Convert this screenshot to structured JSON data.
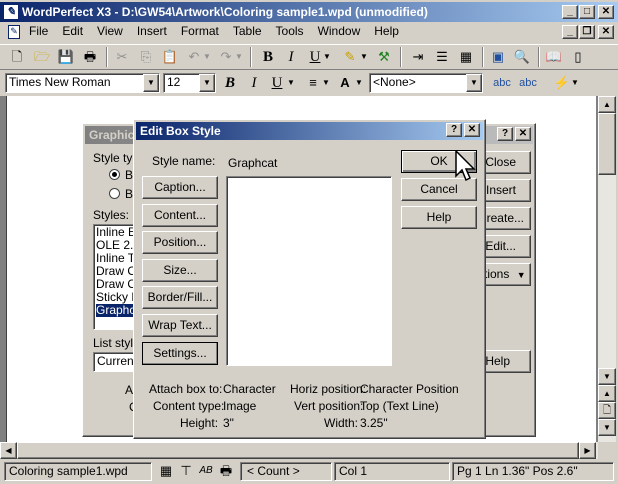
{
  "window": {
    "title": "WordPerfect X3 - D:\\GW54\\Artwork\\Coloring sample1.wpd (unmodified)"
  },
  "menu": [
    "File",
    "Edit",
    "View",
    "Insert",
    "Format",
    "Table",
    "Tools",
    "Window",
    "Help"
  ],
  "font_bar": {
    "font": "Times New Roman",
    "size": "12",
    "style": "<None>"
  },
  "back_dialog": {
    "title": "Graphic",
    "style_type_label": "Style typ",
    "radio1": "B",
    "radio2": "B",
    "styles_label": "Styles:",
    "styles": [
      "Inline Eq",
      "OLE 2.0",
      "Inline Te",
      "Draw O",
      "Draw O",
      "Sticky N",
      "Graphca"
    ],
    "list_style_label": "List style",
    "list_style_value": "Current",
    "btn_close": "Close",
    "btn_insert": "Insert",
    "btn_create": "Create...",
    "btn_edit": "Edit...",
    "btn_options": "Options",
    "btn_help": "Help",
    "a_label": "A",
    "c_label": "C"
  },
  "dialog": {
    "title": "Edit Box Style",
    "style_name_label": "Style name:",
    "style_name_value": "Graphcat",
    "buttons": [
      "Caption...",
      "Content...",
      "Position...",
      "Size...",
      "Border/Fill...",
      "Wrap Text...",
      "Settings..."
    ],
    "ok": "OK",
    "cancel": "Cancel",
    "help": "Help",
    "info": {
      "attach_label": "Attach box to:",
      "attach_value": "Character",
      "content_label": "Content type:",
      "content_value": "Image",
      "height_label": "Height:",
      "height_value": "3\"",
      "horiz_label": "Horiz position:",
      "horiz_value": "Character Position",
      "vert_label": "Vert position:",
      "vert_value": "Top  (Text Line)",
      "width_label": "Width:",
      "width_value": "3.25\""
    }
  },
  "status": {
    "filename": "Coloring sample1.wpd",
    "count": "< Count >",
    "col": "Col 1",
    "position": "Pg 1 Ln 1.36\" Pos 2.6\""
  },
  "colors": {
    "titlebar": "#0a246a",
    "face": "#d4d0c8",
    "selection": "#0a246a"
  },
  "icons": [
    "new-icon",
    "open-icon",
    "save-icon",
    "print-icon",
    "cut-icon",
    "copy-icon",
    "paste-icon",
    "undo-icon",
    "redo-icon",
    "bold-icon",
    "italic-icon",
    "underline-icon",
    "highlight-icon",
    "format-icon",
    "bullets-icon",
    "numbering-icon",
    "table-icon",
    "image-icon",
    "zoom-icon",
    "book-icon",
    "spell-icon"
  ]
}
